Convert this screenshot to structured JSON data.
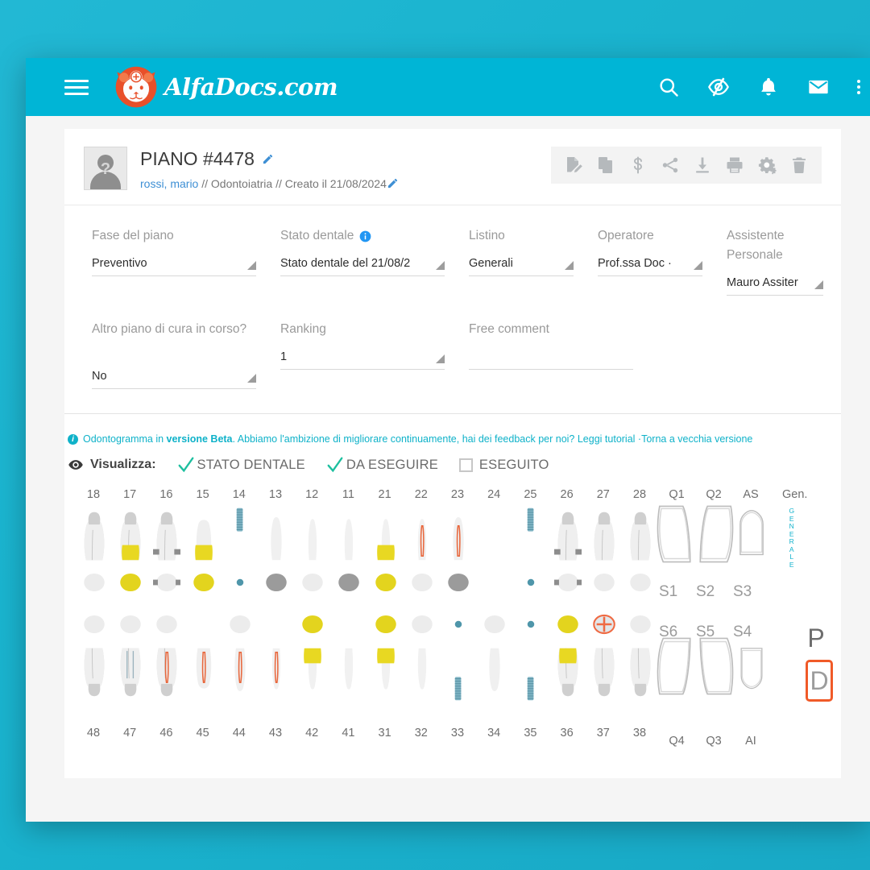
{
  "topbar": {
    "brand_text": "AlfaDocs.com",
    "menu_icon": "hamburger-icon",
    "icons": [
      "search-icon",
      "eye-off-icon",
      "bell-icon",
      "envelope-icon",
      "kebab-menu-icon"
    ],
    "bg_color": "#00b5d6"
  },
  "plan": {
    "title": "PIANO #4478",
    "patient": "rossi, mario",
    "sep1": " // ",
    "department": "Odontoiatria",
    "sep2": " // ",
    "created": "Creato il 21/08/2024",
    "avatar_placeholder": "?",
    "toolbar_icons": [
      "sign-document-icon",
      "copy-icon",
      "dollar-icon",
      "share-icon",
      "download-icon",
      "print-icon",
      "settings-gears-icon",
      "trash-icon"
    ]
  },
  "form": {
    "fields": [
      {
        "label": "Fase del piano",
        "value": "Preventivo",
        "info": false
      },
      {
        "label": "Stato dentale",
        "value": "Stato dentale del 21/08/2",
        "info": true
      },
      {
        "label": "Listino",
        "value": "Generali",
        "info": false
      },
      {
        "label": "Operatore",
        "value": "Prof.ssa Doc ·",
        "info": false
      },
      {
        "label": "Assistente Personale",
        "value": "Mauro Assiter",
        "info": false
      }
    ],
    "fields2": [
      {
        "label": "Altro piano di cura in corso?",
        "value": "No"
      },
      {
        "label": "Ranking",
        "value": "1"
      },
      {
        "label": "Free comment",
        "value": ""
      }
    ]
  },
  "beta": {
    "text_a": "Odontogramma in ",
    "text_bold": "versione Beta",
    "text_b": ". Abbiamo l'ambizione di migliorare continuamente, hai dei feedback per noi? ",
    "link1": "Leggi tutorial",
    "sep": " ·",
    "link2": "Torna a vecchia versione",
    "color": "#0fb2c9"
  },
  "visualizza": {
    "label": "Visualizza:",
    "options": [
      {
        "label": "STATO DENTALE",
        "checked": true
      },
      {
        "label": "DA ESEGUIRE",
        "checked": true
      },
      {
        "label": "ESEGUITO",
        "checked": false
      }
    ],
    "check_color": "#1dbf9f"
  },
  "odontogram": {
    "upper_numbers": [
      "18",
      "17",
      "16",
      "15",
      "14",
      "13",
      "12",
      "11",
      "21",
      "22",
      "23",
      "24",
      "25",
      "26",
      "27",
      "28"
    ],
    "lower_numbers": [
      "48",
      "47",
      "46",
      "45",
      "44",
      "43",
      "42",
      "41",
      "31",
      "32",
      "33",
      "34",
      "35",
      "36",
      "37",
      "38"
    ],
    "upper_extra": [
      "Q1",
      "Q2",
      "AS"
    ],
    "lower_extra": [
      "Q4",
      "Q3",
      "AI"
    ],
    "general_label": "Gen.",
    "general_vertical": "GENERALE",
    "sextants_upper": [
      "S1",
      "S2",
      "S3"
    ],
    "sextants_lower": [
      "S6",
      "S5",
      "S4"
    ],
    "side_labels": {
      "p": "P",
      "d": "D",
      "d_highlight_color": "#f05a28"
    },
    "upper_teeth": [
      {
        "n": "18",
        "type": "molar",
        "crown": "none"
      },
      {
        "n": "17",
        "type": "molar",
        "crown": "gold"
      },
      {
        "n": "16",
        "type": "molar",
        "crown": "bridge"
      },
      {
        "n": "15",
        "type": "premolar",
        "crown": "gold"
      },
      {
        "n": "14",
        "type": "implant",
        "crown": "none"
      },
      {
        "n": "13",
        "type": "canine",
        "crown": "none"
      },
      {
        "n": "12",
        "type": "incisor",
        "crown": "none"
      },
      {
        "n": "11",
        "type": "incisor",
        "crown": "none"
      },
      {
        "n": "21",
        "type": "incisor",
        "crown": "gold"
      },
      {
        "n": "22",
        "type": "incisor",
        "crown": "endo"
      },
      {
        "n": "23",
        "type": "canine",
        "crown": "endo"
      },
      {
        "n": "24",
        "type": "missing",
        "crown": "none"
      },
      {
        "n": "25",
        "type": "implant",
        "crown": "none"
      },
      {
        "n": "26",
        "type": "molar",
        "crown": "bridge"
      },
      {
        "n": "27",
        "type": "molar",
        "crown": "none"
      },
      {
        "n": "28",
        "type": "molar",
        "crown": "none"
      }
    ],
    "lower_teeth": [
      {
        "n": "48",
        "type": "molar",
        "crown": "none"
      },
      {
        "n": "47",
        "type": "molar",
        "crown": "posts"
      },
      {
        "n": "46",
        "type": "molar",
        "crown": "endo"
      },
      {
        "n": "45",
        "type": "premolar",
        "crown": "endo"
      },
      {
        "n": "44",
        "type": "canine",
        "crown": "endo"
      },
      {
        "n": "43",
        "type": "incisor",
        "crown": "endo"
      },
      {
        "n": "42",
        "type": "incisor",
        "crown": "gold"
      },
      {
        "n": "41",
        "type": "incisor",
        "crown": "none"
      },
      {
        "n": "31",
        "type": "incisor",
        "crown": "gold"
      },
      {
        "n": "32",
        "type": "incisor",
        "crown": "none"
      },
      {
        "n": "33",
        "type": "implant",
        "crown": "none"
      },
      {
        "n": "34",
        "type": "canine",
        "crown": "none"
      },
      {
        "n": "35",
        "type": "implant",
        "crown": "none"
      },
      {
        "n": "36",
        "type": "molar",
        "crown": "gold"
      },
      {
        "n": "37",
        "type": "molar",
        "crown": "none"
      },
      {
        "n": "38",
        "type": "molar",
        "crown": "none"
      }
    ],
    "occlusal_upper": [
      {
        "n": "18",
        "fill": "white"
      },
      {
        "n": "17",
        "fill": "gold"
      },
      {
        "n": "16",
        "fill": "bridge"
      },
      {
        "n": "15",
        "fill": "gold"
      },
      {
        "n": "14",
        "fill": "implant-dot"
      },
      {
        "n": "13",
        "fill": "metal"
      },
      {
        "n": "12",
        "fill": "white"
      },
      {
        "n": "11",
        "fill": "metal"
      },
      {
        "n": "21",
        "fill": "gold"
      },
      {
        "n": "22",
        "fill": "white"
      },
      {
        "n": "23",
        "fill": "metal"
      },
      {
        "n": "24",
        "fill": "none"
      },
      {
        "n": "25",
        "fill": "implant-dot"
      },
      {
        "n": "26",
        "fill": "bridge"
      },
      {
        "n": "27",
        "fill": "white"
      },
      {
        "n": "28",
        "fill": "white"
      }
    ],
    "occlusal_lower": [
      {
        "n": "48",
        "fill": "white"
      },
      {
        "n": "47",
        "fill": "white"
      },
      {
        "n": "46",
        "fill": "white"
      },
      {
        "n": "45",
        "fill": "none"
      },
      {
        "n": "44",
        "fill": "white"
      },
      {
        "n": "43",
        "fill": "none"
      },
      {
        "n": "42",
        "fill": "gold"
      },
      {
        "n": "41",
        "fill": "none"
      },
      {
        "n": "31",
        "fill": "gold"
      },
      {
        "n": "32",
        "fill": "white"
      },
      {
        "n": "33",
        "fill": "implant-dot"
      },
      {
        "n": "34",
        "fill": "white"
      },
      {
        "n": "35",
        "fill": "implant-dot"
      },
      {
        "n": "36",
        "fill": "gold"
      },
      {
        "n": "37",
        "fill": "outlined"
      },
      {
        "n": "38",
        "fill": "white"
      }
    ]
  }
}
